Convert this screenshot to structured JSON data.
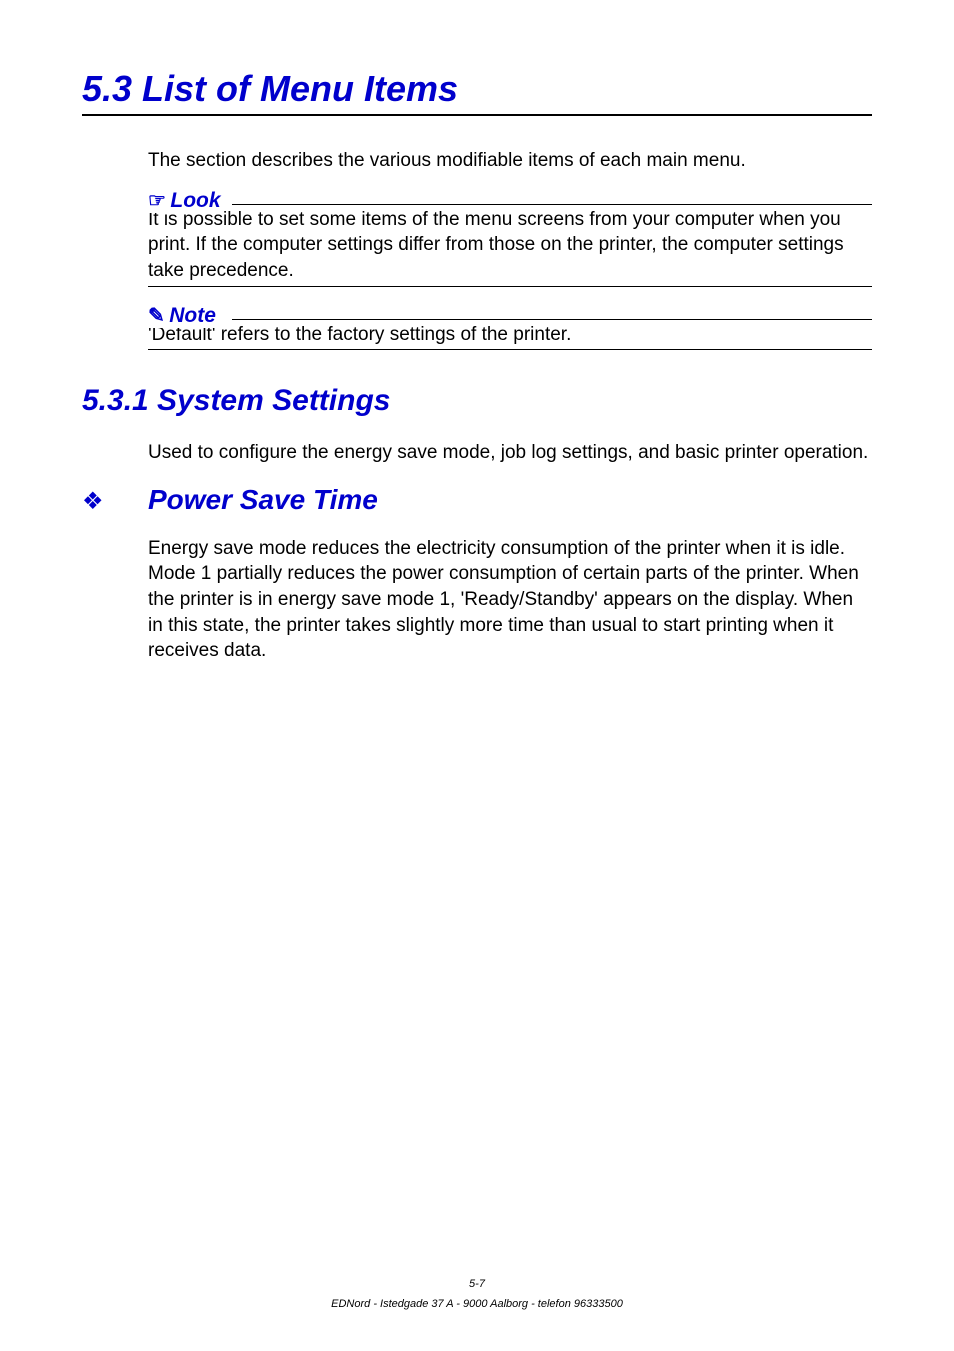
{
  "chapter": {
    "number_title": "5.3   List of Menu Items"
  },
  "intro": "The section describes the various modifiable items of each main menu.",
  "look": {
    "icon": "☞",
    "label": "Look",
    "body": "It is possible to set some items of the menu screens from your computer when you print. If the computer settings differ from those on the printer, the computer settings take precedence."
  },
  "note": {
    "icon": "✎",
    "label": "Note",
    "body": "'Default' refers to the factory settings of the printer."
  },
  "section": {
    "title": "5.3.1  System Settings",
    "intro": "Used to configure the energy save mode, job log settings, and basic printer operation."
  },
  "subsection": {
    "icon": "❖",
    "title": "Power Save Time",
    "body": "Energy save mode reduces the electricity consumption of the printer when it is idle. Mode 1 partially reduces the power consumption of certain parts of the printer. When the printer is in energy save mode 1, 'Ready/Standby' appears on the display. When in this state, the printer takes slightly more time than usual to start printing when it receives data."
  },
  "footer": {
    "page": "5-7",
    "line": "EDNord - Istedgade 37 A - 9000 Aalborg - telefon 96333500"
  }
}
